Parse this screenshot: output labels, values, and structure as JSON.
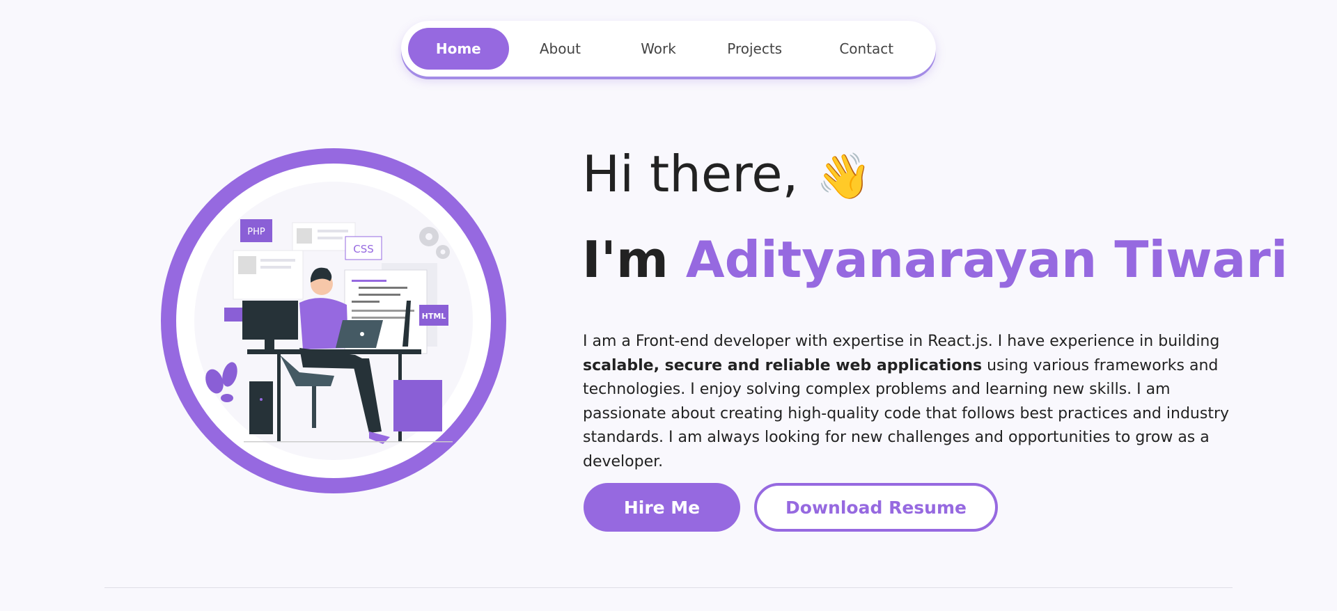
{
  "nav": {
    "items": [
      "Home",
      "About",
      "Work",
      "Projects",
      "Contact"
    ],
    "active": "Home"
  },
  "hero": {
    "greeting": "Hi there,",
    "wave_emoji": "👋",
    "intro_prefix": "I'm ",
    "name": "Adityanarayan Tiwari",
    "bio": {
      "part1": "I am a Front-end developer with expertise in React.js. I have experience in building ",
      "bold": "scalable, secure and reliable web applications",
      "part2": " using various frameworks and technologies. I enjoy solving complex problems and learning new skills. I am passionate about creating high-quality code that follows best practices and industry standards. I am always looking for new challenges and opportunities to grow as a developer."
    },
    "illustration_labels": {
      "php": "PHP",
      "css": "CSS",
      "html": "HTML"
    }
  },
  "buttons": {
    "hire": "Hire Me",
    "resume": "Download Resume"
  },
  "colors": {
    "accent": "#9669e0",
    "background": "#f9f8fd",
    "text": "#222222"
  }
}
